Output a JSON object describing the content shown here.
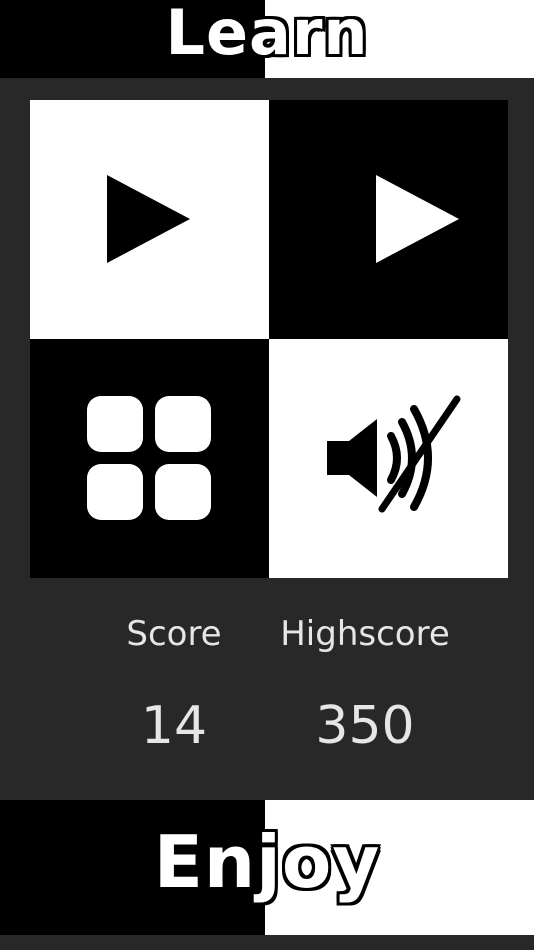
{
  "header": {
    "title": "Learn"
  },
  "footer": {
    "title": "Enjoy"
  },
  "menu": {
    "tiles": [
      {
        "icon": "play-icon",
        "action": "play"
      },
      {
        "icon": "play-icon",
        "action": "play"
      },
      {
        "icon": "grid-icon",
        "action": "levels"
      },
      {
        "icon": "sound-off-icon",
        "action": "sound"
      }
    ]
  },
  "stats": {
    "score_label": "Score",
    "score_value": "14",
    "highscore_label": "Highscore",
    "highscore_value": "350"
  },
  "colors": {
    "background": "#282828",
    "tile_light": "#ffffff",
    "tile_dark": "#000000",
    "text": "#e6e6e6"
  }
}
